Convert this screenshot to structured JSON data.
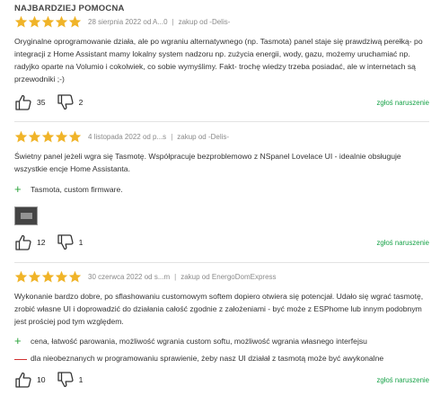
{
  "section_title": "NAJBARDZIEJ POMOCNA",
  "colors": {
    "star": "#f0b429",
    "plus": "#2aa339",
    "minus": "#cc2222",
    "link": "#1aa34a"
  },
  "reviews": [
    {
      "rating": 5,
      "date": "28 sierpnia 2022 od A...0",
      "purchase": "zakup od -Delis-",
      "text": "Oryginalne oprogramowanie działa, ale po wgraniu alternatywnego (np. Tasmota) panel staje się prawdziwą perełką- po integracji z Home Assistant mamy lokalny system nadzoru np. zużycia energii, wody, gazu, możemy uruchamiać np. radyjko oparte na Volumio i cokolwiek, co sobie wymyślimy. Fakt- trochę wiedzy trzeba posiadać, ale w internetach są przewodniki ;-)",
      "pros": [],
      "cons": [],
      "likes": "35",
      "dislikes": "2",
      "report": "zgłoś naruszenie"
    },
    {
      "rating": 5,
      "date": "4 listopada 2022 od p...s",
      "purchase": "zakup od -Delis-",
      "text": "Świetny panel jeżeli wgra się Tasmotę. Współpracuje bezproblemowo z NSpanel Lovelace UI - idealnie obsługuje wszystkie encje Home Assistanta.",
      "pros": [
        "Tasmota, custom firmware."
      ],
      "cons": [],
      "likes": "12",
      "dislikes": "1",
      "report": "zgłoś naruszenie"
    },
    {
      "rating": 5,
      "date": "30 czerwca 2022 od s...m",
      "purchase": "zakup od EnergoDomExpress",
      "text": "Wykonanie bardzo dobre, po sflashowaniu customowym softem dopiero otwiera się potencjał. Udało się wgrać tasmotę, zrobić własne UI i doprowadzić do działania całość zgodnie z założeniami - być może z ESPhome lub innym podobnym jest prościej pod tym względem.",
      "pros": [
        "cena, łatwość parowania, możliwość wgrania custom softu, możliwość wgrania własnego interfejsu"
      ],
      "cons": [
        "dla nieobeznanych w programowaniu sprawienie, żeby nasz UI działał z tasmotą może być awykonalne"
      ],
      "likes": "10",
      "dislikes": "1",
      "report": "zgłoś naruszenie"
    }
  ]
}
